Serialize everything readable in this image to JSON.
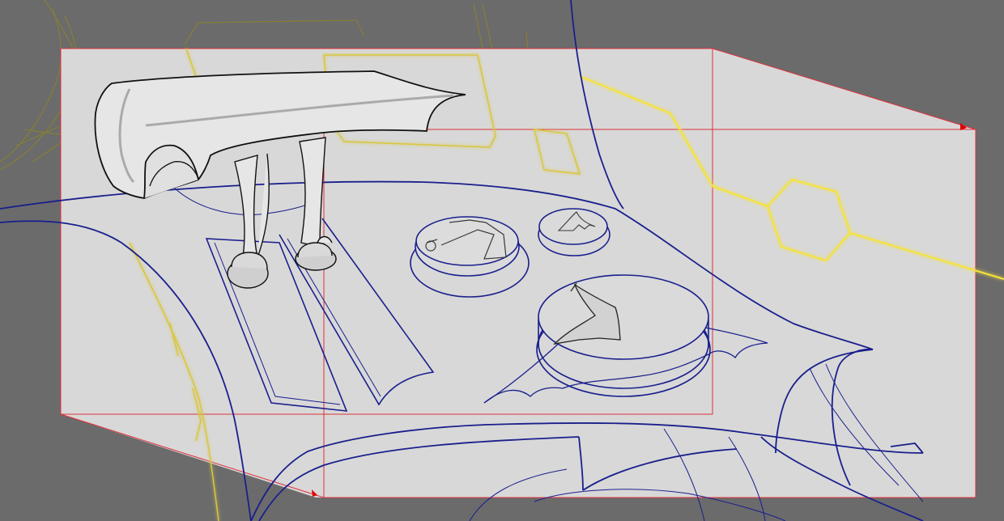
{
  "viewport": {
    "background_color": "#6b6b6b",
    "perspective_box_fill": "#d9d9d9",
    "perspective_guide_color": "#e0303a",
    "vanishing_marker_color": "#e00000",
    "blue_linework_color": "#1a1f8c",
    "black_linework_color": "#111111",
    "yellow_guide_color": "#f4e23a",
    "olive_sketch_color": "#8a8130"
  },
  "elements": {
    "handle_shape": "gearshift-handle",
    "dials": [
      "large-dial",
      "top-left-dial",
      "small-dial"
    ],
    "slots": [
      "left-slot",
      "right-slot"
    ],
    "guides": [
      "perspective-box",
      "hexagon-guide"
    ]
  }
}
